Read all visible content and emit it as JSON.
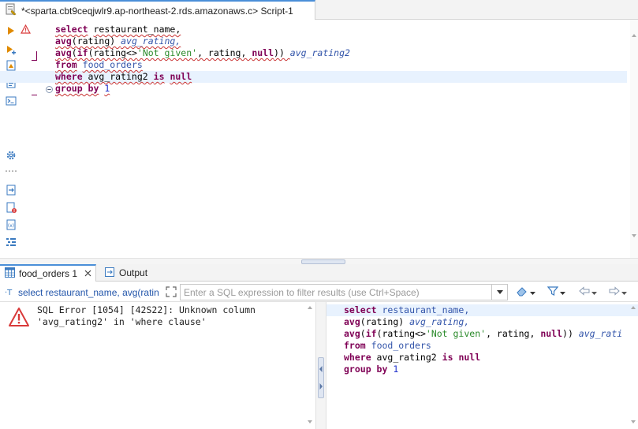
{
  "editor_tab": {
    "title": "*<sparta.cbt9ceqjwlr9.ap-northeast-2.rds.amazonaws.c> Script-1"
  },
  "editor": {
    "lines": [
      [
        {
          "t": "select",
          "c": "kw sq"
        },
        {
          "t": " ",
          "c": ""
        },
        {
          "t": "restaurant_name,",
          "c": "sq"
        }
      ],
      [
        {
          "t": "avg",
          "c": "kw sq"
        },
        {
          "t": "(rating) ",
          "c": "sq"
        },
        {
          "t": "avg_rating,",
          "c": "alias sq"
        }
      ],
      [
        {
          "t": "avg",
          "c": "kw sq"
        },
        {
          "t": "(",
          "c": "sq"
        },
        {
          "t": "if",
          "c": "kw sq"
        },
        {
          "t": "(rating<>",
          "c": "sq"
        },
        {
          "t": "'Not given'",
          "c": "str sq"
        },
        {
          "t": ", rating, ",
          "c": "sq"
        },
        {
          "t": "null",
          "c": "kw sq"
        },
        {
          "t": ")) ",
          "c": "sq"
        },
        {
          "t": "avg_rating2",
          "c": "alias"
        }
      ],
      [
        {
          "t": "from",
          "c": "kw sq"
        },
        {
          "t": " ",
          "c": ""
        },
        {
          "t": "food_orders",
          "c": "tbl sq"
        }
      ],
      [
        {
          "t": "where",
          "c": "kw sq"
        },
        {
          "t": " avg_rating2 ",
          "c": "sq"
        },
        {
          "t": "is",
          "c": "kw sq"
        },
        {
          "t": " ",
          "c": ""
        },
        {
          "t": "null",
          "c": "kw sq"
        }
      ],
      [
        {
          "t": "group by",
          "c": "kw sq"
        },
        {
          "t": " ",
          "c": ""
        },
        {
          "t": "1",
          "c": "num sq"
        }
      ]
    ]
  },
  "result_tabs": {
    "results_label": "food_orders 1",
    "output_label": "Output"
  },
  "filter_bar": {
    "query_text": "select restaurant_name, avg(ratin",
    "placeholder": "Enter a SQL expression to filter results (use Ctrl+Space)"
  },
  "error": {
    "message": "SQL Error [1054] [42S22]: Unknown column\n'avg_rating2' in 'where clause'"
  },
  "sql_panel": {
    "lines": [
      [
        {
          "t": "select",
          "c": "kw"
        },
        {
          "t": " ",
          "c": ""
        },
        {
          "t": "restaurant_name,",
          "c": "tbl"
        }
      ],
      [
        {
          "t": "avg",
          "c": "kw"
        },
        {
          "t": "(rating) ",
          "c": ""
        },
        {
          "t": "avg_rating,",
          "c": "alias"
        }
      ],
      [
        {
          "t": "avg",
          "c": "kw"
        },
        {
          "t": "(",
          "c": ""
        },
        {
          "t": "if",
          "c": "kw"
        },
        {
          "t": "(rating<>",
          "c": ""
        },
        {
          "t": "'Not given'",
          "c": "str"
        },
        {
          "t": ", rating, ",
          "c": ""
        },
        {
          "t": "null",
          "c": "kw"
        },
        {
          "t": ")) ",
          "c": ""
        },
        {
          "t": "avg_rati",
          "c": "alias"
        }
      ],
      [
        {
          "t": "from",
          "c": "kw"
        },
        {
          "t": " ",
          "c": ""
        },
        {
          "t": "food_orders",
          "c": "tbl"
        }
      ],
      [
        {
          "t": "where",
          "c": "kw"
        },
        {
          "t": " avg_rating2 ",
          "c": ""
        },
        {
          "t": "is",
          "c": "kw"
        },
        {
          "t": " ",
          "c": ""
        },
        {
          "t": "null",
          "c": "kw"
        }
      ],
      [
        {
          "t": "group by",
          "c": "kw"
        },
        {
          "t": " ",
          "c": ""
        },
        {
          "t": "1",
          "c": "num"
        }
      ]
    ]
  },
  "colors": {
    "accent": "#4a8fd8",
    "keyword": "#7f0055",
    "identifier": "#3355aa",
    "string": "#2a8a2a",
    "error": "#d93a3a",
    "warning": "#e8a317"
  },
  "icons": [
    "sql-file-icon",
    "run-icon",
    "warning-icon",
    "run-script-icon",
    "explain-icon",
    "format-icon",
    "terminal-icon",
    "gear-icon",
    "export-icon",
    "error-doc-icon",
    "sql-doc-icon",
    "outline-icon",
    "grid-icon",
    "output-icon",
    "filter-icon",
    "eraser-icon",
    "funnel-icon",
    "back-icon",
    "forward-icon",
    "error-icon"
  ]
}
